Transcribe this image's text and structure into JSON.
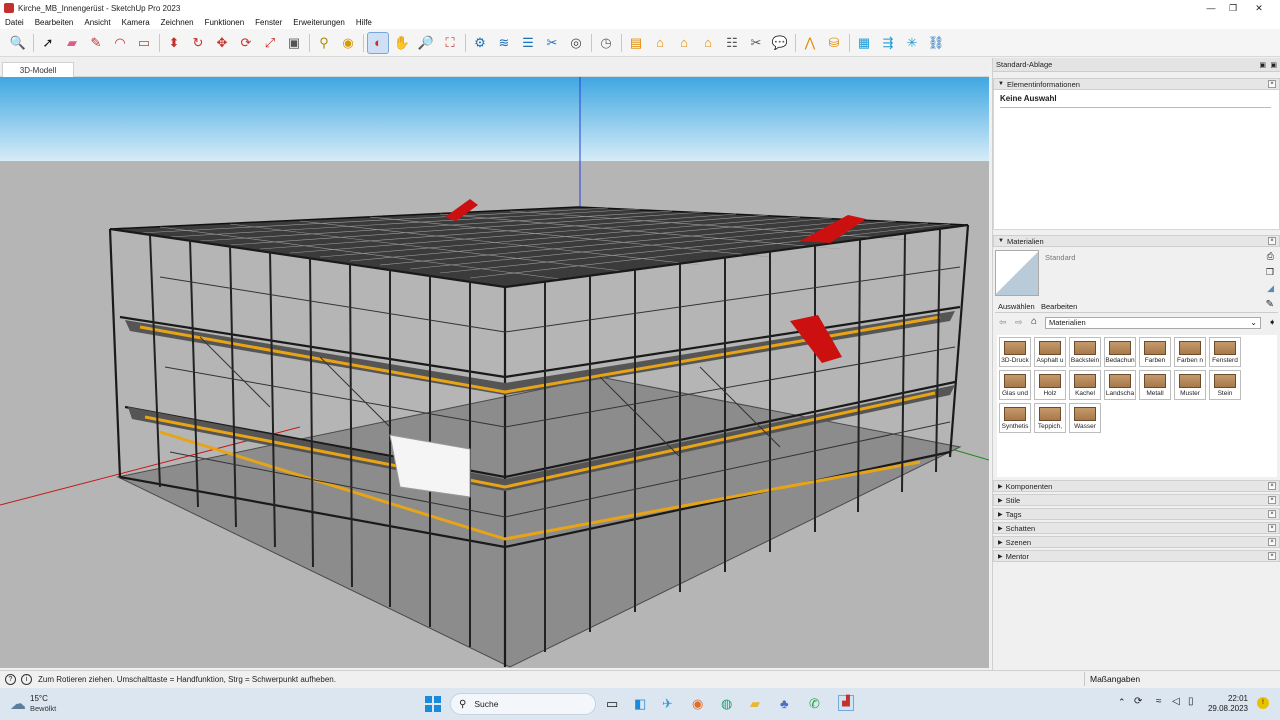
{
  "window": {
    "title": "Kirche_MB_Innengerüst - SketchUp Pro 2023"
  },
  "menu": [
    "Datei",
    "Bearbeiten",
    "Ansicht",
    "Kamera",
    "Zeichnen",
    "Funktionen",
    "Fenster",
    "Erweiterungen",
    "Hilfe"
  ],
  "toolbar_icons": [
    "zoom-extents-icon",
    "select-icon",
    "eraser-icon",
    "line-icon",
    "arc-icon",
    "rectangle-icon",
    "push-pull-icon",
    "follow-me-icon",
    "move-icon",
    "rotate-icon",
    "scale-icon",
    "offset-icon",
    "tape-measure-icon",
    "paint-bucket-icon",
    "orbit-icon",
    "pan-icon",
    "zoom-icon",
    "zoom-window-icon",
    "section-icon",
    "layers-icon",
    "styles-icon",
    "camera-icon",
    "timer-icon",
    "report-icon",
    "house-icon",
    "house2-icon",
    "house3-icon",
    "list-icon",
    "tools-icon",
    "chat-icon",
    "roof-icon",
    "database-icon",
    "scaffold-icon",
    "export-icon",
    "network-icon",
    "link-icon"
  ],
  "tab": {
    "label": "3D-Modell"
  },
  "panel": {
    "title": "Standard-Ablage",
    "entity_info": {
      "header": "Elementinformationen",
      "value": "Keine Auswahl"
    },
    "materials": {
      "header": "Materialien",
      "current": "Standard",
      "tabs": [
        "Auswählen",
        "Bearbeiten"
      ],
      "library": "Materialien",
      "items": [
        "3D-Druck",
        "Asphalt u",
        "Backstein",
        "Bedachun",
        "Farben",
        "Farben n",
        "Fensterd",
        "Glas und",
        "Holz",
        "Kachel",
        "Landscha",
        "Metall",
        "Muster",
        "Stein",
        "Synthetis",
        "Teppich,",
        "Wasser"
      ]
    },
    "collapsed_sections": [
      "Komponenten",
      "Stile",
      "Tags",
      "Schatten",
      "Szenen",
      "Mentor"
    ]
  },
  "status": {
    "message": "Zum Rotieren ziehen. Umschalttaste = Handfunktion, Strg = Schwerpunkt aufheben.",
    "measurements_label": "Maßangaben"
  },
  "taskbar": {
    "weather_temp": "15°C",
    "weather_desc": "Bewölkt",
    "search": "Suche",
    "time": "22:01",
    "date": "29.08.2023"
  },
  "colors": {
    "sky_top": "#3fa7e2",
    "ground": "#b5b5b5",
    "accent": "#0067c0",
    "scaffold_yellow": "#e8a417",
    "marker_red": "#cc1010"
  }
}
